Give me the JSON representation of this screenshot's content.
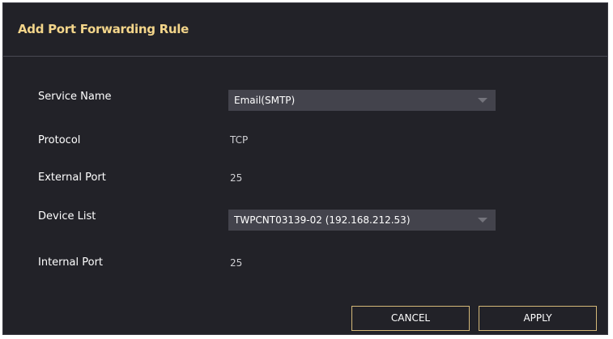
{
  "dialog": {
    "title": "Add Port Forwarding Rule"
  },
  "form": {
    "service_name": {
      "label": "Service Name",
      "value": "Email(SMTP)"
    },
    "protocol": {
      "label": "Protocol",
      "value": "TCP"
    },
    "external_port": {
      "label": "External Port",
      "value": "25"
    },
    "device_list": {
      "label": "Device List",
      "value": "TWPCNT03139-02 (192.168.212.53)"
    },
    "internal_port": {
      "label": "Internal Port",
      "value": "25"
    }
  },
  "buttons": {
    "cancel_label": "CANCEL",
    "apply_label": "APPLY"
  },
  "colors": {
    "background": "#222228",
    "title": "#f3d58a",
    "select_bg": "#43434c",
    "button_border": "#d4b878"
  }
}
